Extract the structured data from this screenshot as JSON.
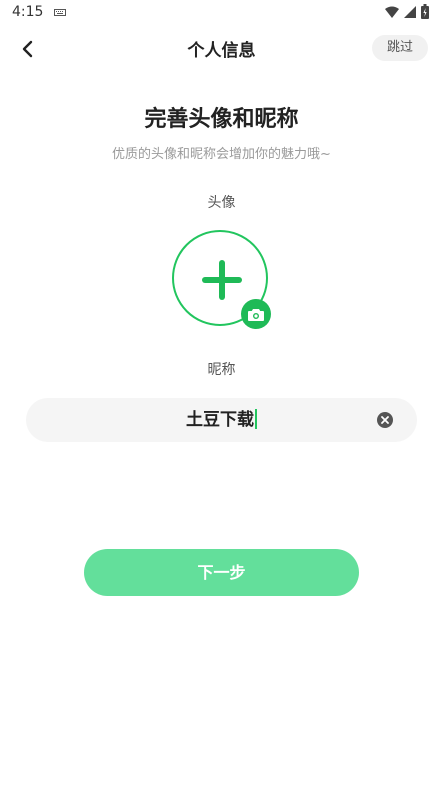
{
  "status_bar": {
    "time": "4:15",
    "icons": [
      "keyboard-icon",
      "wifi-icon",
      "signal-icon",
      "battery-icon"
    ]
  },
  "header": {
    "title": "个人信息",
    "skip_label": "跳过",
    "back_icon": "chevron-left-icon"
  },
  "main": {
    "title": "完善头像和昵称",
    "subtitle": "优质的头像和昵称会增加你的魅力哦~",
    "avatar_label": "头像",
    "nickname_label": "昵称",
    "nickname_value": "土豆下载",
    "next_label": "下一步"
  },
  "colors": {
    "accent": "#22c55e",
    "camera_badge": "#1fba57",
    "next_button": "#63df9b",
    "field_bg": "#f5f5f5"
  }
}
